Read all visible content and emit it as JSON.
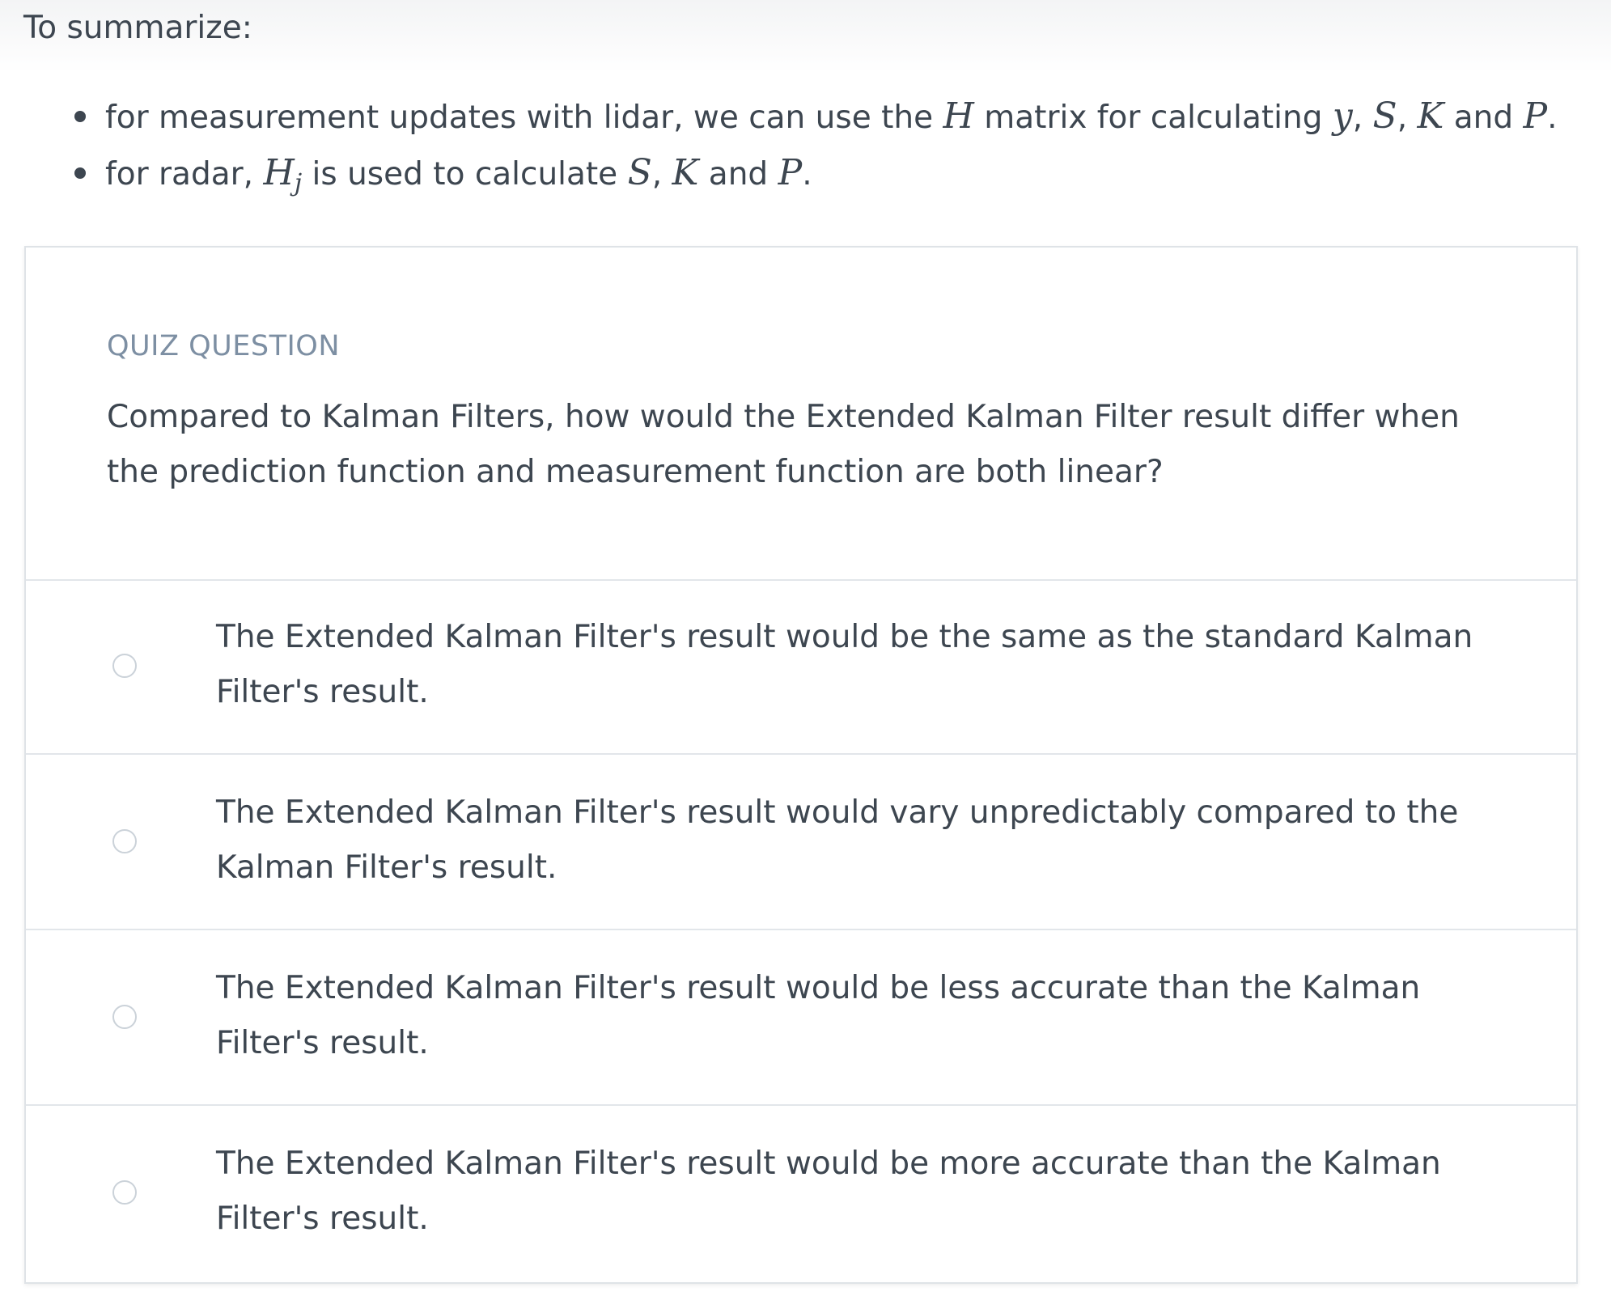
{
  "summary": {
    "title": "To summarize:",
    "items": [
      {
        "t1": "for measurement updates with lidar, we can use the ",
        "m1": "H",
        "t2": " matrix for calculating ",
        "m2": "y",
        "t3": ", ",
        "m3": "S",
        "t4": ", ",
        "m4": "K",
        "t5": " and ",
        "m5": "P",
        "t6": "."
      },
      {
        "t1": "for radar, ",
        "m1": "H",
        "m1sub": "j",
        "t2": " is used to calculate ",
        "m2": "S",
        "t3": ", ",
        "m3": "K",
        "t4": " and ",
        "m4": "P",
        "t5": "."
      }
    ]
  },
  "quiz": {
    "label": "QUIZ QUESTION",
    "question": "Compared to Kalman Filters, how would the Extended Kalman Filter result differ when the prediction function and measurement function are both linear?",
    "options": [
      "The Extended Kalman Filter's result would be the same as the standard Kalman Filter's result.",
      "The Extended Kalman Filter's result would vary unpredictably compared to the Kalman Filter's result.",
      "The Extended Kalman Filter's result would be less accurate than the Kalman Filter's result.",
      "The Extended Kalman Filter's result would be more accurate than the Kalman Filter's result."
    ]
  }
}
